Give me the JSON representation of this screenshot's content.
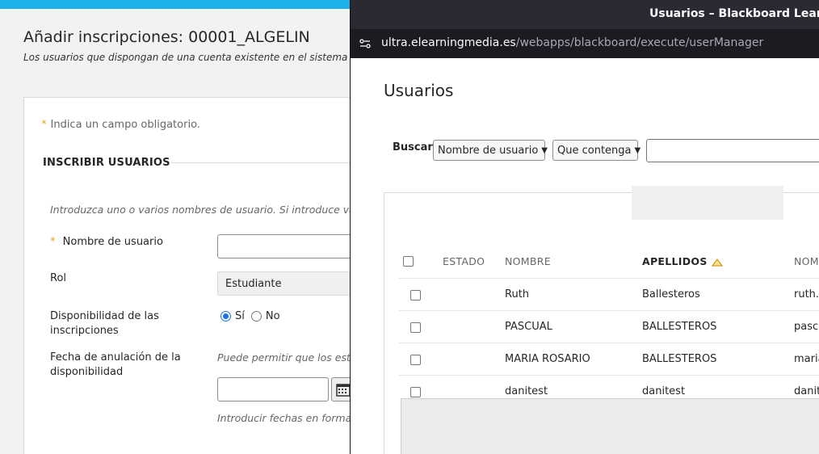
{
  "background": {
    "title": "Añadir inscripciones: 00001_ALGELIN",
    "subtitle": "Los usuarios que dispongan de una cuenta existente en el sistema se pu",
    "required_note": "Indica un campo obligatorio.",
    "section_heading": "INSCRIBIR USUARIOS",
    "intro": "Introduzca uno o varios nombres de usuario. Si introduce vario",
    "username_label": "Nombre de usuario",
    "role_label": "Rol",
    "role_value": "Estudiante",
    "availability_label": "Disponibilidad de las inscripciones",
    "availability_yes": "Sí",
    "availability_no": "No",
    "cancel_date_label": "Fecha de anulación de la disponibilidad",
    "cancel_date_hint": "Puede permitir que los estudi",
    "date_format_hint": "Introducir fechas en formato",
    "accent_color": "#1cb1e8"
  },
  "popup": {
    "window_title": "Usuarios – Blackboard Learn - G",
    "url_domain": "ultra.elearningmedia.es",
    "url_path": "/webapps/blackboard/execute/userManager",
    "page_title": "Usuarios",
    "search_label": "Buscar",
    "search_field_selected": "Nombre de usuario",
    "search_operator_selected": "Que contenga",
    "columns": {
      "status": "ESTADO",
      "first_name": "NOMBRE",
      "last_name": "APELLIDOS",
      "username": "NOM"
    },
    "rows": [
      {
        "first_name": "Ruth",
        "last_name": "Ballesteros",
        "username": "ruth.b"
      },
      {
        "first_name": "PASCUAL",
        "last_name": "BALLESTEROS",
        "username": "pascu"
      },
      {
        "first_name": "MARIA ROSARIO",
        "last_name": "BALLESTEROS",
        "username": "maria"
      },
      {
        "first_name": "danitest",
        "last_name": "danitest",
        "username": "danite"
      }
    ]
  }
}
